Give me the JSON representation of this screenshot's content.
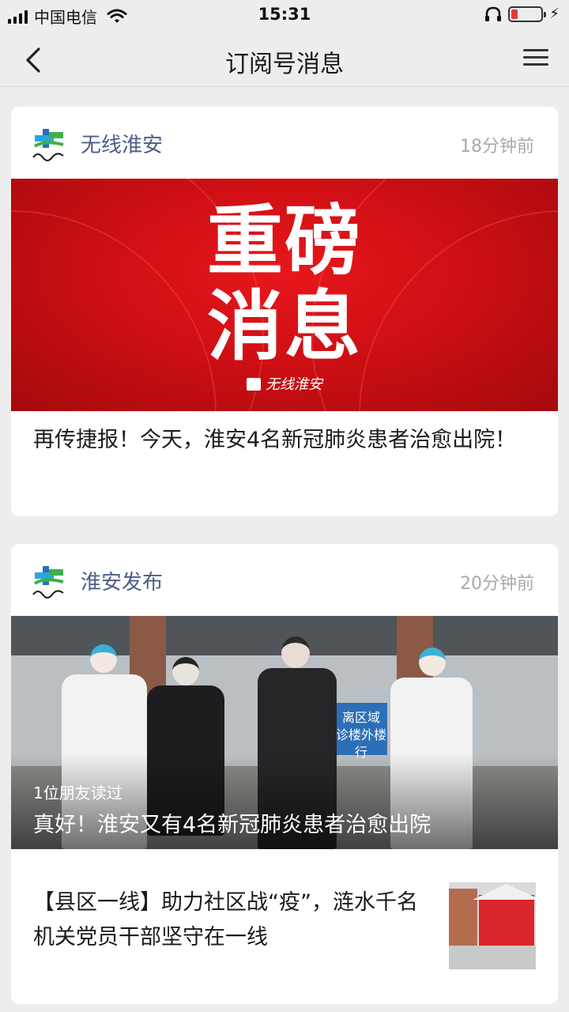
{
  "status_bar": {
    "carrier": "中国电信",
    "time": "15:31"
  },
  "nav": {
    "title": "订阅号消息"
  },
  "cards": [
    {
      "account": "无线淮安",
      "time_ago": "18分钟前",
      "banner_line1": "重磅",
      "banner_line2": "消息",
      "banner_brand": "无线淮安",
      "headline": "再传捷报！今天，淮安4名新冠肺炎患者治愈出院！"
    },
    {
      "account": "淮安发布",
      "time_ago": "20分钟前",
      "photo_sign": "离区域 诊楼外楼行",
      "friend_read": "1位朋友读过",
      "photo_title": "真好！淮安又有4名新冠肺炎患者治愈出院",
      "sub_article_title": "【县区一线】助力社区战“疫”，涟水千名机关党员干部坚守在一线"
    }
  ],
  "colors": {
    "background": "#ededed",
    "account_name": "#4a5e86",
    "banner_red": "#d0101a"
  }
}
